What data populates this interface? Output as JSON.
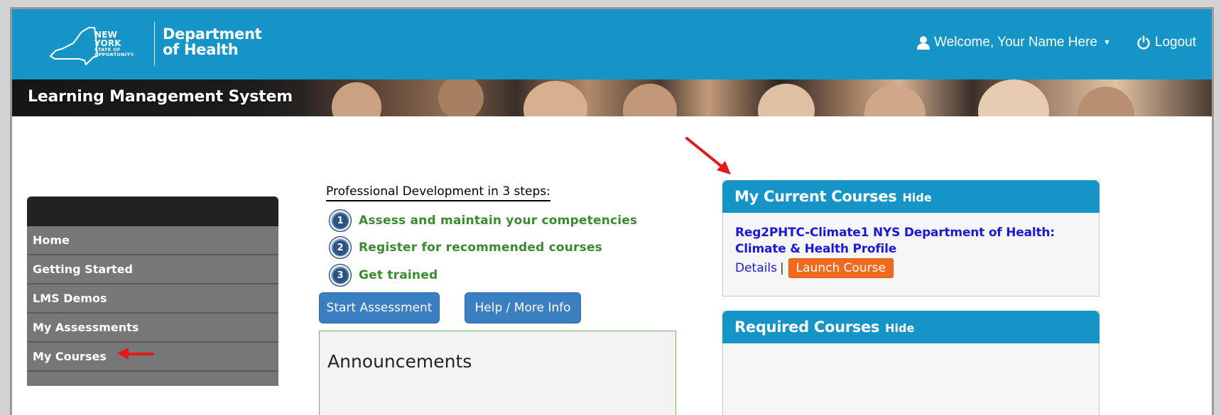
{
  "header": {
    "logo": {
      "state_line1": "NEW YORK",
      "state_line2": "STATE OF",
      "state_line3": "OPPORTUNITY.",
      "dept_line1": "Department",
      "dept_line2": "of Health"
    },
    "welcome": "Welcome, Your Name Here",
    "logout": "Logout"
  },
  "banner": {
    "title": "Learning Management System"
  },
  "sidebar": {
    "items": [
      {
        "label": "Home"
      },
      {
        "label": "Getting Started"
      },
      {
        "label": "LMS Demos"
      },
      {
        "label": "My Assessments"
      },
      {
        "label": "My Courses"
      }
    ]
  },
  "steps": {
    "title": "Professional Development in 3 steps:",
    "items": [
      {
        "num": "1",
        "label": "Assess and maintain your competencies"
      },
      {
        "num": "2",
        "label": "Register for recommended courses"
      },
      {
        "num": "3",
        "label": "Get trained"
      }
    ]
  },
  "buttons": {
    "start_assessment": "Start Assessment",
    "help": "Help / More Info"
  },
  "announcements": {
    "title": "Announcements"
  },
  "current_courses": {
    "title": "My Current Courses",
    "hide": "Hide",
    "course_title": "Reg2PHTC-Climate1 NYS Department of Health: Climate & Health Profile",
    "details": "Details",
    "separator": "|",
    "launch": "Launch Course"
  },
  "required_courses": {
    "title": "Required Courses",
    "hide": "Hide"
  },
  "colors": {
    "header_blue": "#1594c8",
    "button_blue": "#3a7fc1",
    "launch_orange": "#f26a1b",
    "step_green": "#3a8a2e",
    "annotation_red": "#e01b1b"
  }
}
